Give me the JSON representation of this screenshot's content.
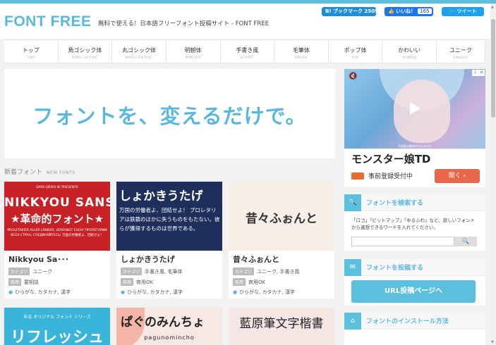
{
  "header": {
    "logo": "FONT FREE",
    "tagline": "無料で使える！日本語フリーフォント投稿サイト - FONT FREE",
    "share": {
      "hatena_label": "B! ブックマーク",
      "hatena_count": "2509",
      "fb_label": "いいね！",
      "fb_count": "165",
      "tw_label": "ツイート"
    }
  },
  "nav": {
    "items": [
      {
        "label": "トップ",
        "sub": "TOP"
      },
      {
        "label": "角ゴシック体",
        "sub": "KAKU-GOTHIC"
      },
      {
        "label": "丸ゴシック体",
        "sub": "MARU-GOTHIC"
      },
      {
        "label": "明朝体",
        "sub": "MINCHO"
      },
      {
        "label": "手書き風",
        "sub": "SCRIPT"
      },
      {
        "label": "毛筆体",
        "sub": "BRUSH"
      },
      {
        "label": "ポップ体",
        "sub": "POP"
      },
      {
        "label": "かわいい",
        "sub": "KAWAII"
      },
      {
        "label": "ユニーク",
        "sub": "UNIQUE"
      }
    ]
  },
  "hero": {
    "text": "フォントを、変えるだけで。"
  },
  "section": {
    "title": "新着フォント",
    "title_en": "NEW FONTS"
  },
  "cards": [
    {
      "name": "Nikkyou Sa･･･",
      "category_tag": "カテゴリ",
      "category": "ユニーク",
      "license_tag": "商用",
      "license": "要相談",
      "chars": "ひらがな, カタカナ, 漢字",
      "img_top": "DARE-DEMO IIE PRESENTS",
      "img_big": "NIKKYOU SANS",
      "img_big2": "★革命的フォント★",
      "img_small": "PROLETARIER ALLER LÄNDER, VEREINIGT EUCH! ПРОЛЕТАРИИ ВСЕХ СТРАН, СОЕДИНЯЙТЕСЬ! 万国の労働者よ、団結せよ！"
    },
    {
      "name": "しょかきうたげ",
      "category_tag": "カテゴリ",
      "category": "手書き風, 毛筆体",
      "license_tag": "商用",
      "license": "商用OK",
      "chars": "ひらがな, カタカナ, 漢字",
      "img_big": "しょかきうたげ",
      "img_lines": "万国の労働者よ、団結せよ！ プロレタリアは鉄鎖のほかに失うものをもたない。彼らが獲得するものは世界である。"
    },
    {
      "name": "昔々ふぉんと",
      "category_tag": "カテゴリ",
      "category": "ユニーク, 手書き風",
      "license_tag": "商用",
      "license": "商用OK",
      "chars": "ひらがな, カタカナ, 漢字",
      "img_big": "昔々ふぉんと"
    },
    {
      "img_t1": "ゆる オリジナル フォント シリーズ",
      "img_t2": "リフレッシュ"
    },
    {
      "img_t1": "ぱぐのみんちょ",
      "img_t2": "pagunomincho"
    },
    {
      "img_t1": "藍原筆文字楷書"
    }
  ],
  "ad": {
    "caption": "※画面は開発中のものです",
    "title": "モンスター娘TD",
    "sub": "事前登録受付中",
    "button": "開く ›",
    "adchoice": "i",
    "close": "✕"
  },
  "widgets": {
    "search": {
      "title": "フォントを検索する",
      "desc": "「ロゴ」「ビットマップ」「ゆるふわ」など、欲しいフォントから連想できるワードを入れてください。",
      "placeholder": ""
    },
    "post": {
      "title": "フォントを投稿する",
      "button": "URL投稿ページへ"
    },
    "install": {
      "title": "フォントのインストール方法"
    }
  }
}
